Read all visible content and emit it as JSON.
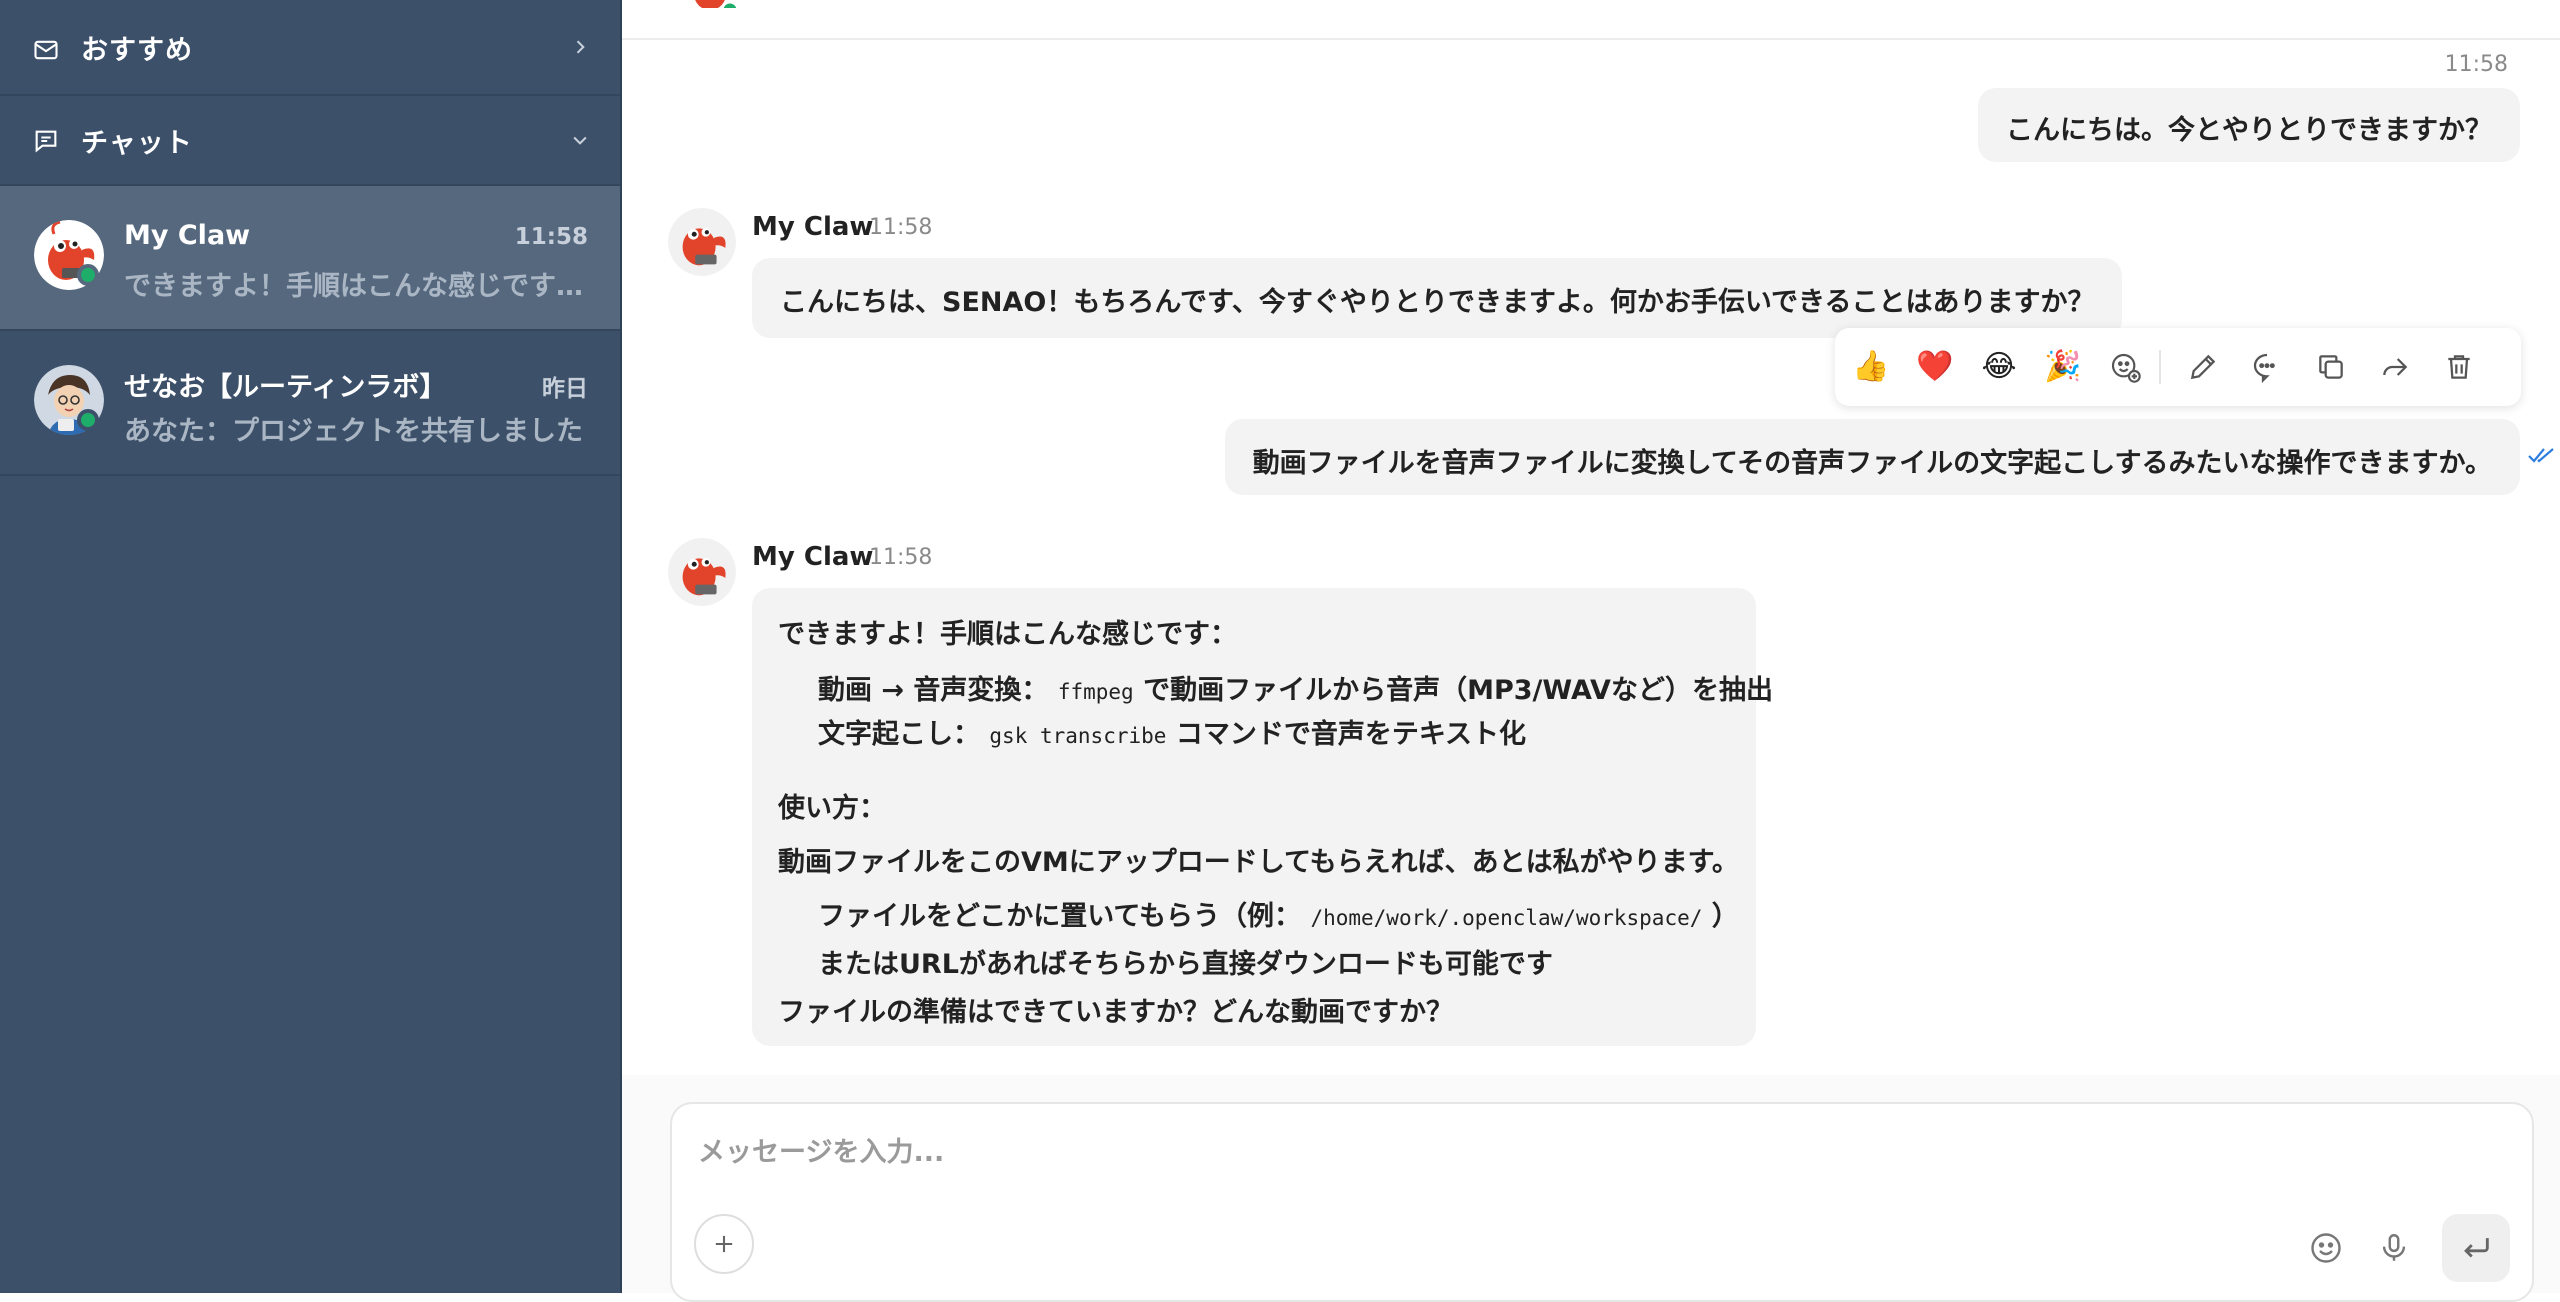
{
  "sidebar": {
    "sections": [
      {
        "label": "おすすめ",
        "icon": "mail-icon",
        "chevron": "chevron-right-icon"
      },
      {
        "label": "チャット",
        "icon": "chat-list-icon",
        "chevron": "chevron-down-icon"
      }
    ],
    "chats": [
      {
        "name": "My Claw",
        "time": "11:58",
        "preview": "できますよ！手順はこんな感じです：動画 → 音声変換",
        "active": true
      },
      {
        "name": "せなお【ルーティンラボ】",
        "time": "昨日",
        "preview": "あなた：プロジェクトを共有しました",
        "active": false
      }
    ]
  },
  "conversation": {
    "timestamp": "11:58",
    "msg1_out": "こんにちは。今とやりとりできますか？",
    "msg2": {
      "sender": "My Claw",
      "time": "11:58",
      "text": "こんにちは、SENAO！もちろんです、今すぐやりとりできますよ。何かお手伝いできることはありますか？"
    },
    "msg3_out": "動画ファイルを音声ファイルに変換してその音声ファイルの文字起こしするみたいな操作できますか。",
    "msg4": {
      "sender": "My Claw",
      "time": "11:58",
      "intro": "できますよ！手順はこんな感じです：",
      "step1_a": "動画 → 音声変換：",
      "step1_code": "ffmpeg",
      "step1_b": "で動画ファイルから音声（MP3/WAVなど）を抽出",
      "step2_a": "文字起こし：",
      "step2_code": "gsk transcribe",
      "step2_b": "コマンドで音声をテキスト化",
      "usage_title": "使い方：",
      "usage_line": "動画ファイルをこのVMにアップロードしてもらえれば、あとは私がやります。",
      "bullet1_a": "ファイルをどこかに置いてもらう（例：",
      "bullet1_code": "/home/work/.openclaw/workspace/",
      "bullet1_b": "）",
      "bullet2": "またはURLがあればそちらから直接ダウンロードも可能です",
      "closing": "ファイルの準備はできていますか？どんな動画ですか？"
    }
  },
  "reactions": [
    "👍",
    "❤️",
    "😂",
    "🎉"
  ],
  "message_actions": [
    "add-reaction-icon",
    "edit-icon",
    "reply-icon",
    "copy-icon",
    "forward-icon",
    "delete-icon"
  ],
  "composer": {
    "placeholder": "メッセージを入力..."
  },
  "colors": {
    "sidebar": "#3c5169",
    "sidebar_active": "#55687e",
    "online": "#1fae6a",
    "read_check": "#2b7de0"
  }
}
